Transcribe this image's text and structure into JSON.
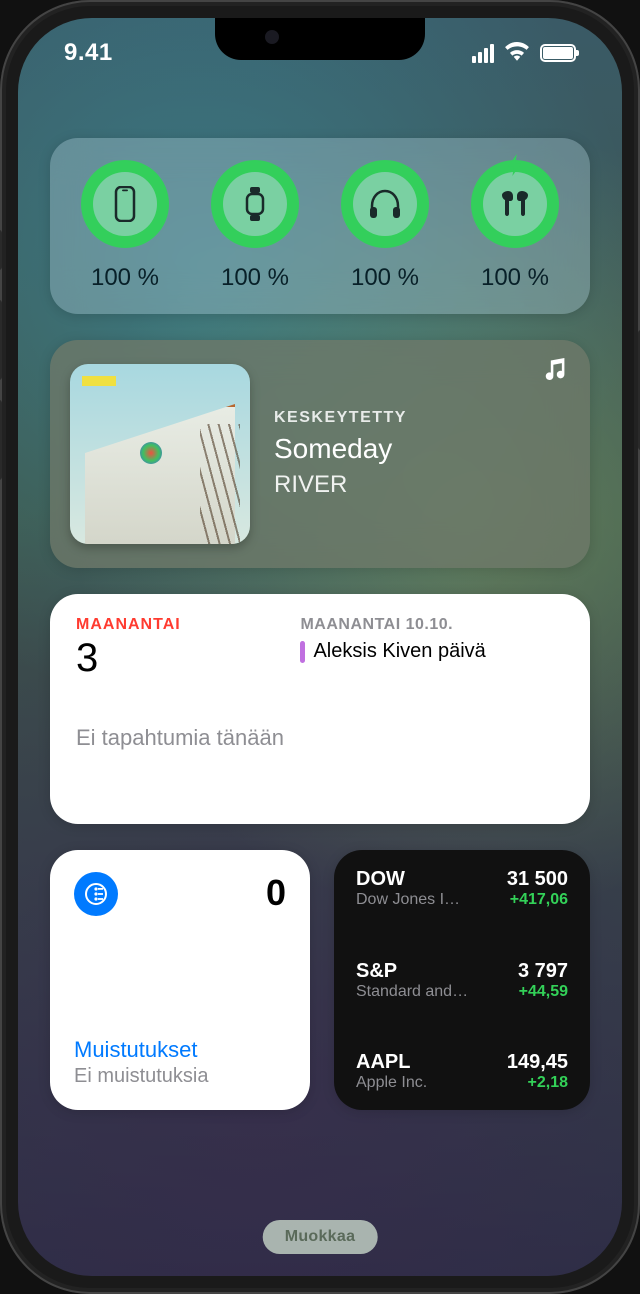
{
  "status_bar": {
    "time": "9.41"
  },
  "batteries": {
    "items": [
      {
        "device": "iphone",
        "percent_label": "100 %"
      },
      {
        "device": "watch",
        "percent_label": "100 %"
      },
      {
        "device": "headphones",
        "percent_label": "100 %"
      },
      {
        "device": "airpods",
        "percent_label": "100 %",
        "charging": true
      }
    ]
  },
  "music": {
    "status": "KESKEYTETTY",
    "track": "Someday",
    "artist": "RIVER"
  },
  "calendar": {
    "today_label": "MAANANTAI",
    "today_number": "3",
    "next_date_label": "MAANANTAI 10.10.",
    "next_event": "Aleksis Kiven päivä",
    "empty_text": "Ei tapahtumia tänään"
  },
  "reminders": {
    "count": "0",
    "title": "Muistutukset",
    "subtitle": "Ei muistutuksia"
  },
  "stocks": {
    "rows": [
      {
        "symbol": "DOW",
        "name": "Dow Jones I…",
        "price": "31 500",
        "change": "+417,06"
      },
      {
        "symbol": "S&P",
        "name": "Standard and…",
        "price": "3 797",
        "change": "+44,59"
      },
      {
        "symbol": "AAPL",
        "name": "Apple Inc.",
        "price": "149,45",
        "change": "+2,18"
      }
    ]
  },
  "edit_button": "Muokkaa",
  "colors": {
    "green": "#33cf5b",
    "blue": "#007aff",
    "red": "#ff3b30",
    "stock_up": "#33d158"
  }
}
